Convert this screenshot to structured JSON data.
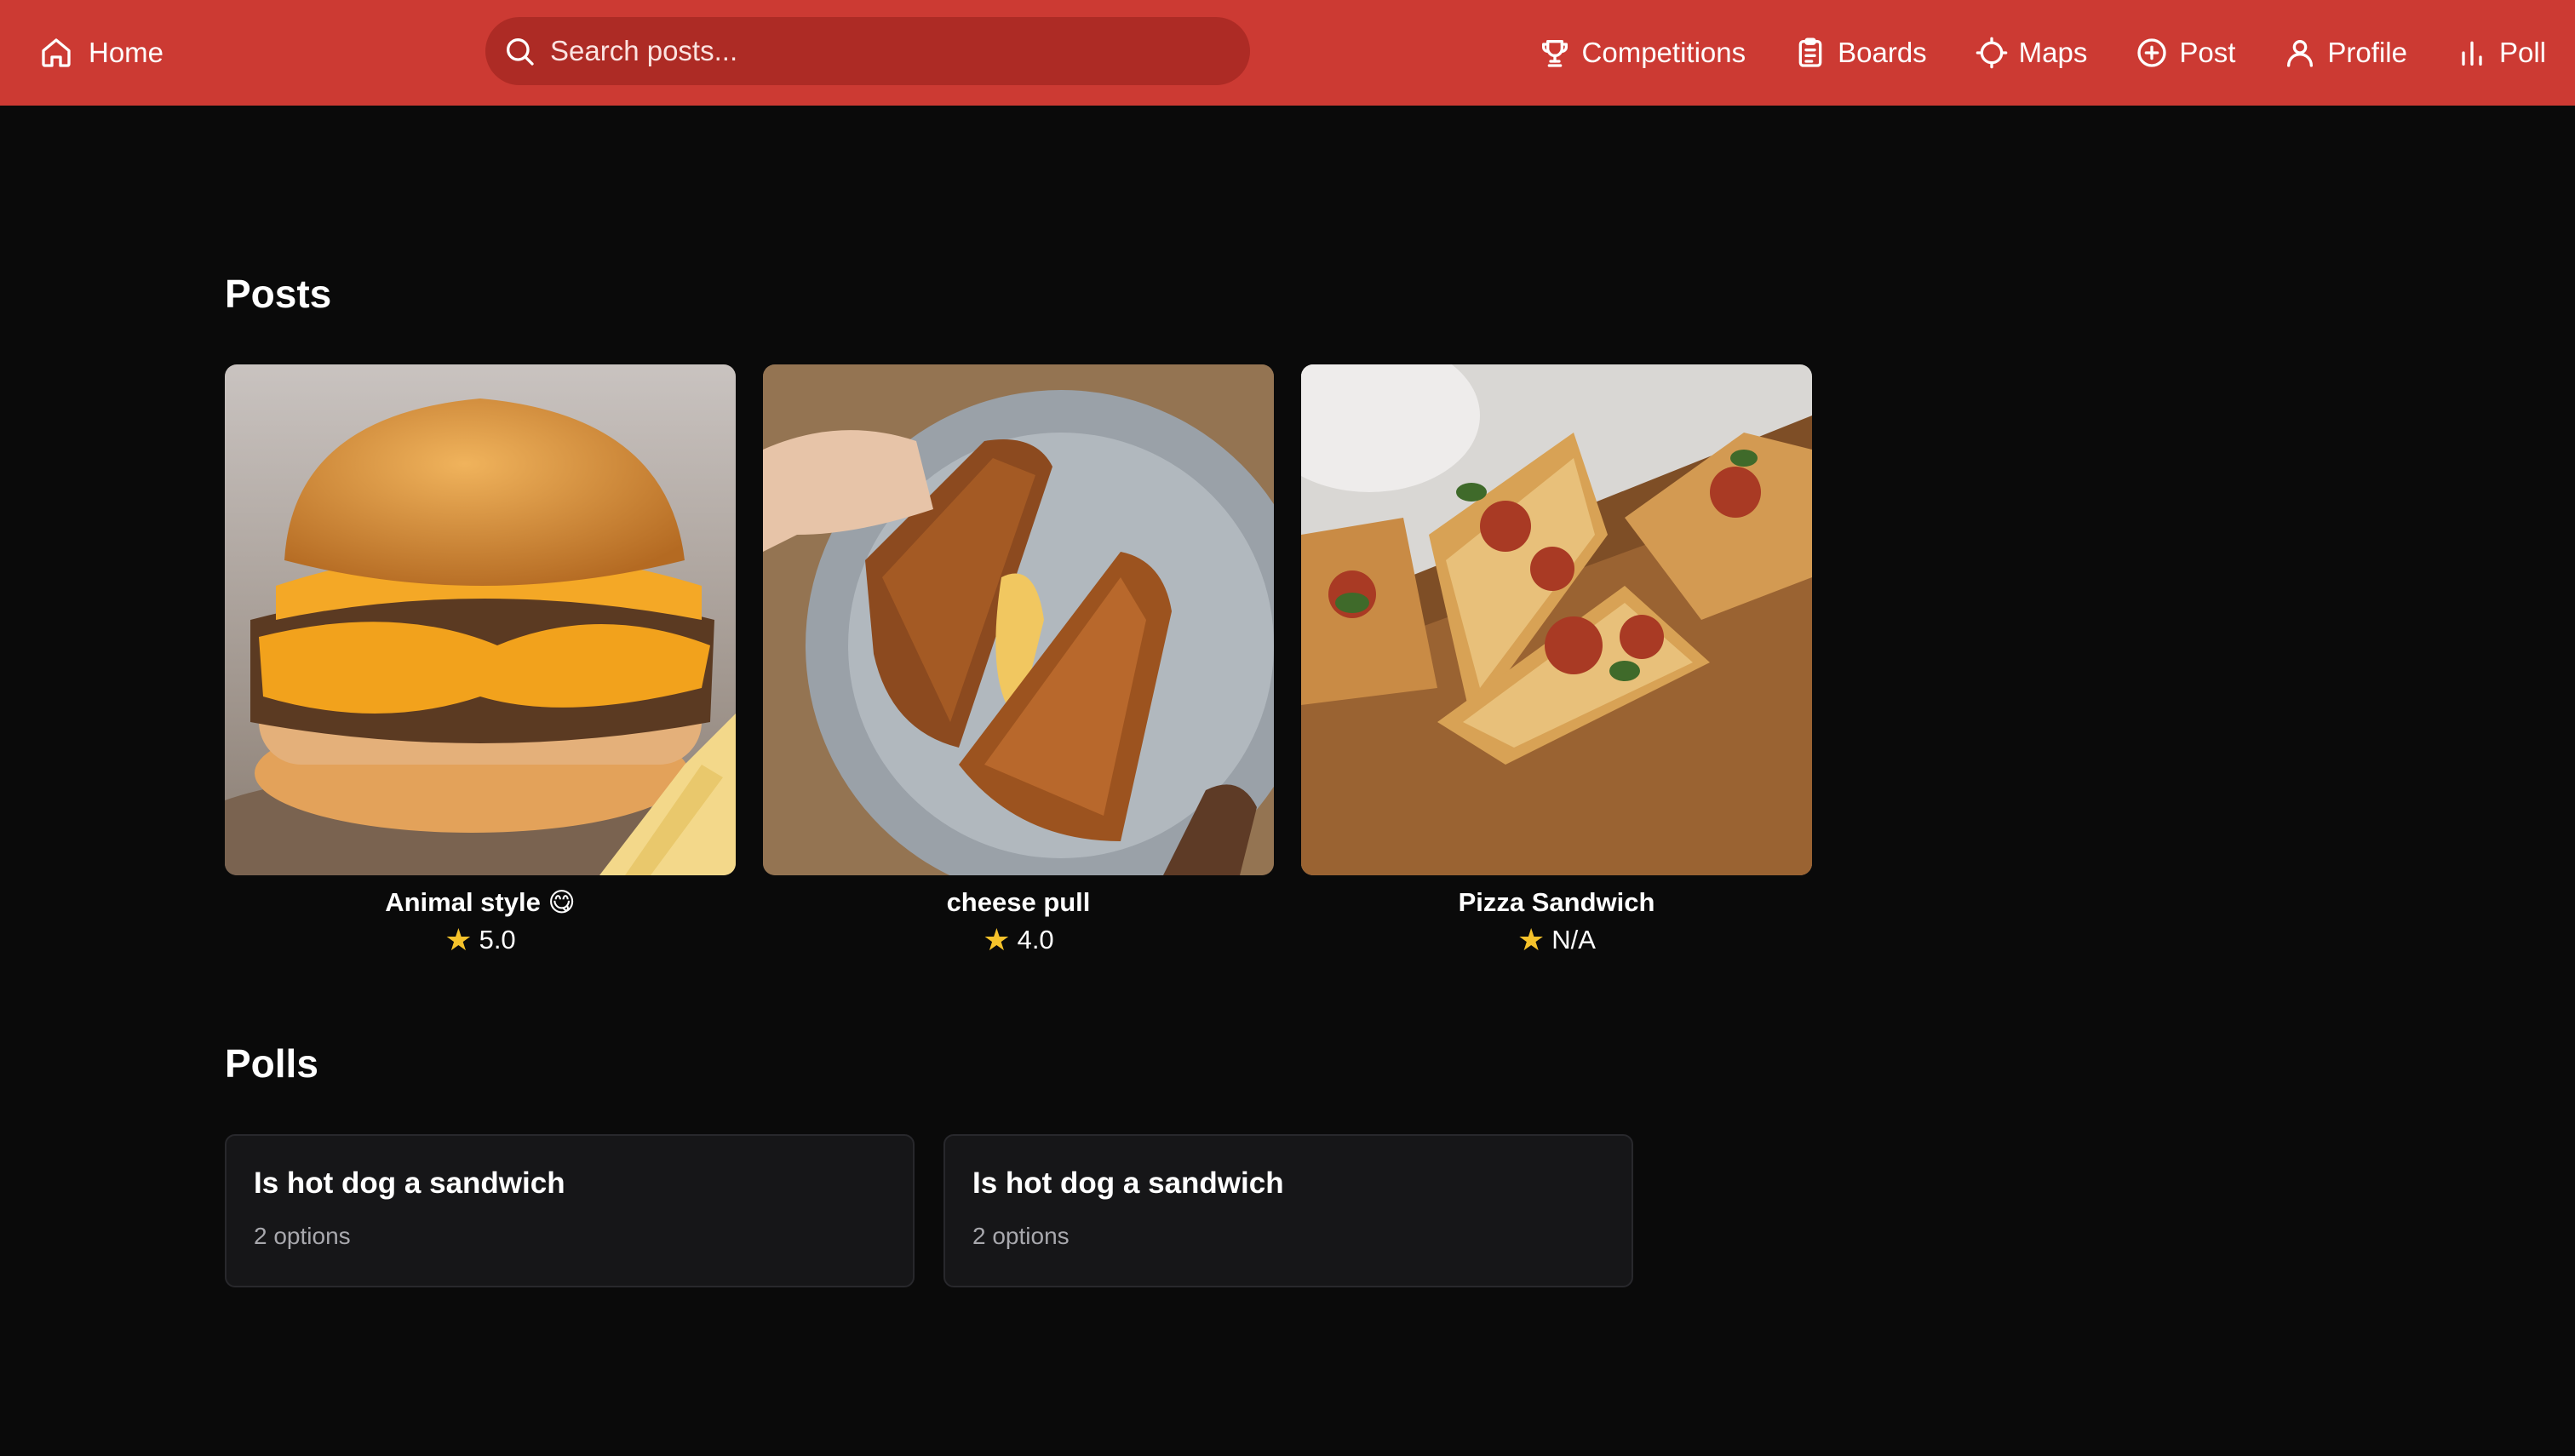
{
  "nav": {
    "home_label": "Home",
    "search_placeholder": "Search posts...",
    "items": [
      {
        "label": "Competitions",
        "icon": "trophy-icon"
      },
      {
        "label": "Boards",
        "icon": "clipboard-icon"
      },
      {
        "label": "Maps",
        "icon": "crosshair-icon"
      },
      {
        "label": "Post",
        "icon": "plus-circle-icon"
      },
      {
        "label": "Profile",
        "icon": "user-icon"
      },
      {
        "label": "Poll",
        "icon": "bar-chart-icon"
      }
    ]
  },
  "posts": {
    "heading": "Posts",
    "items": [
      {
        "title": "Animal style 😋",
        "rating": "5.0"
      },
      {
        "title": "cheese pull",
        "rating": "4.0"
      },
      {
        "title": "Pizza Sandwich",
        "rating": "N/A"
      }
    ]
  },
  "polls": {
    "heading": "Polls",
    "items": [
      {
        "question": "Is hot dog a sandwich",
        "options_text": "2 options"
      },
      {
        "question": "Is hot dog a sandwich",
        "options_text": "2 options"
      }
    ]
  },
  "colors": {
    "navbar": "#cc3a33",
    "search_bg": "#ad2b25",
    "background": "#0a0a0a",
    "star": "#f5c22b",
    "card": "#161618"
  }
}
